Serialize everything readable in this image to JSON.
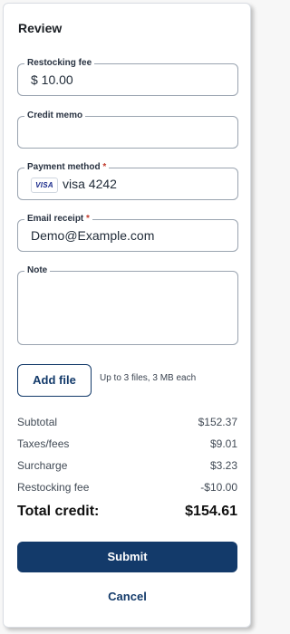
{
  "panel": {
    "title": "Review"
  },
  "fields": {
    "restocking_fee": {
      "label": "Restocking fee",
      "value": "$ 10.00"
    },
    "credit_memo": {
      "label": "Credit memo",
      "value": ""
    },
    "payment_method": {
      "label": "Payment method",
      "required_mark": "*",
      "card_brand": "VISA",
      "value": "visa 4242"
    },
    "email_receipt": {
      "label": "Email receipt",
      "required_mark": "*",
      "value": "Demo@Example.com"
    },
    "note": {
      "label": "Note",
      "value": ""
    }
  },
  "attachments": {
    "button_label": "Add file",
    "hint": "Up to 3 files, 3 MB each"
  },
  "summary": {
    "rows": [
      {
        "label": "Subtotal",
        "value": "$152.37"
      },
      {
        "label": "Taxes/fees",
        "value": "$9.01"
      },
      {
        "label": "Surcharge",
        "value": "$3.23"
      },
      {
        "label": "Restocking fee",
        "value": "-$10.00"
      }
    ],
    "total_label": "Total credit:",
    "total_value": "$154.61"
  },
  "actions": {
    "submit_label": "Submit",
    "cancel_label": "Cancel"
  },
  "colors": {
    "primary": "#133a6a",
    "required": "#c0392b"
  }
}
